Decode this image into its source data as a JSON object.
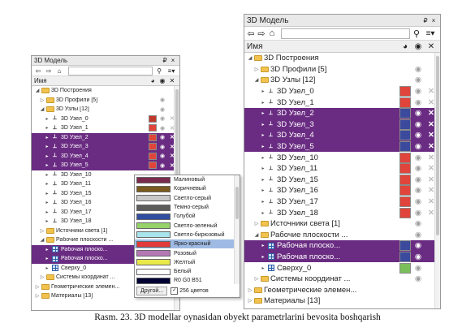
{
  "small_panel": {
    "title": "3D Модель",
    "pin": "₽",
    "close": "×",
    "column_header": "Имя",
    "rows": [
      {
        "label": "3D Построения",
        "depth": 0,
        "exp": "◢",
        "icon": "folder"
      },
      {
        "label": "3D Профили [5]",
        "depth": 1,
        "exp": "▷",
        "icon": "folder",
        "eye": "on"
      },
      {
        "label": "3D Узлы [12]",
        "depth": 1,
        "exp": "◢",
        "icon": "folder",
        "eye": "on"
      },
      {
        "label": "3D Узел_0",
        "depth": 2,
        "exp": "▸",
        "icon": "node",
        "color": "#c0392b",
        "eye": "on",
        "x": "off"
      },
      {
        "label": "3D Узел_1",
        "depth": 2,
        "exp": "▸",
        "icon": "node",
        "color": "#e0443a",
        "eye": "on",
        "x": "off"
      },
      {
        "label": "3D Узел_2",
        "depth": 2,
        "exp": "▸",
        "icon": "node",
        "color": "#e0443a",
        "eye": "on",
        "x": "on",
        "sel": true
      },
      {
        "label": "3D Узел_3",
        "depth": 2,
        "exp": "▸",
        "icon": "node",
        "color": "#e0443a",
        "eye": "on",
        "x": "on",
        "sel": true
      },
      {
        "label": "3D Узел_4",
        "depth": 2,
        "exp": "▸",
        "icon": "node",
        "color": "#e0443a",
        "eye": "on",
        "x": "on",
        "sel": true
      },
      {
        "label": "3D Узел_5",
        "depth": 2,
        "exp": "▸",
        "icon": "node",
        "color": "#e0443a",
        "eye": "on",
        "x": "on",
        "sel": true
      },
      {
        "label": "3D Узел_10",
        "depth": 2,
        "exp": "▸",
        "icon": "node"
      },
      {
        "label": "3D Узел_11",
        "depth": 2,
        "exp": "▸",
        "icon": "node"
      },
      {
        "label": "3D Узел_15",
        "depth": 2,
        "exp": "▸",
        "icon": "node"
      },
      {
        "label": "3D Узел_16",
        "depth": 2,
        "exp": "▸",
        "icon": "node"
      },
      {
        "label": "3D Узел_17",
        "depth": 2,
        "exp": "▸",
        "icon": "node"
      },
      {
        "label": "3D Узел_18",
        "depth": 2,
        "exp": "▸",
        "icon": "node"
      },
      {
        "label": "Источники света [1]",
        "depth": 1,
        "exp": "▷",
        "icon": "folder"
      },
      {
        "label": "Рабочие плоскости ...",
        "depth": 1,
        "exp": "◢",
        "icon": "folder"
      },
      {
        "label": "Рабочая плоско...",
        "depth": 2,
        "exp": "▸",
        "icon": "grid",
        "sel": true
      },
      {
        "label": "Рабочая плоско...",
        "depth": 2,
        "exp": "▸",
        "icon": "grid",
        "sel": true
      },
      {
        "label": "Сверху_0",
        "depth": 2,
        "exp": "▸",
        "icon": "grid"
      },
      {
        "label": "Системы координат ...",
        "depth": 1,
        "exp": "▷",
        "icon": "folder"
      },
      {
        "label": "Геометрические элемен...",
        "depth": 0,
        "exp": "▷",
        "icon": "folder"
      },
      {
        "label": "Материалы [13]",
        "depth": 0,
        "exp": "▷",
        "icon": "folder"
      }
    ]
  },
  "large_panel": {
    "title": "3D Модель",
    "pin": "₽",
    "close": "×",
    "column_header": "Имя",
    "rows": [
      {
        "label": "3D Построения",
        "depth": 0,
        "exp": "◢",
        "icon": "folder"
      },
      {
        "label": "3D Профили [5]",
        "depth": 1,
        "exp": "▷",
        "icon": "folder",
        "eye": "on"
      },
      {
        "label": "3D Узлы [12]",
        "depth": 1,
        "exp": "◢",
        "icon": "folder",
        "eye": "on"
      },
      {
        "label": "3D Узел_0",
        "depth": 2,
        "exp": "▸",
        "icon": "node",
        "color": "#e0443a",
        "eye": "on",
        "x": "off"
      },
      {
        "label": "3D Узел_1",
        "depth": 2,
        "exp": "▸",
        "icon": "node",
        "color": "#e0443a",
        "eye": "on",
        "x": "off"
      },
      {
        "label": "3D Узел_2",
        "depth": 2,
        "exp": "▸",
        "icon": "node",
        "color": "#3b4a9c",
        "eye": "on",
        "x": "on",
        "sel": true
      },
      {
        "label": "3D Узел_3",
        "depth": 2,
        "exp": "▸",
        "icon": "node",
        "color": "#3b4a9c",
        "eye": "on",
        "x": "on",
        "sel": true
      },
      {
        "label": "3D Узел_4",
        "depth": 2,
        "exp": "▸",
        "icon": "node",
        "color": "#3b4a9c",
        "eye": "on",
        "x": "on",
        "sel": true
      },
      {
        "label": "3D Узел_5",
        "depth": 2,
        "exp": "▸",
        "icon": "node",
        "color": "#3b4a9c",
        "eye": "on",
        "x": "on",
        "sel": true
      },
      {
        "label": "3D Узел_10",
        "depth": 2,
        "exp": "▸",
        "icon": "node",
        "color": "#e0443a",
        "eye": "on",
        "x": "off"
      },
      {
        "label": "3D Узел_11",
        "depth": 2,
        "exp": "▸",
        "icon": "node",
        "color": "#e0443a",
        "eye": "on",
        "x": "off"
      },
      {
        "label": "3D Узел_15",
        "depth": 2,
        "exp": "▸",
        "icon": "node",
        "color": "#e0443a",
        "eye": "on",
        "x": "off"
      },
      {
        "label": "3D Узел_16",
        "depth": 2,
        "exp": "▸",
        "icon": "node",
        "color": "#e0443a",
        "eye": "on",
        "x": "off"
      },
      {
        "label": "3D Узел_17",
        "depth": 2,
        "exp": "▸",
        "icon": "node",
        "color": "#e0443a",
        "eye": "on",
        "x": "off"
      },
      {
        "label": "3D Узел_18",
        "depth": 2,
        "exp": "▸",
        "icon": "node",
        "color": "#e0443a",
        "eye": "on",
        "x": "off"
      },
      {
        "label": "Источники света [1]",
        "depth": 1,
        "exp": "▷",
        "icon": "folder",
        "eye": "on"
      },
      {
        "label": "Рабочие плоскости ...",
        "depth": 1,
        "exp": "◢",
        "icon": "folder",
        "eye": "on"
      },
      {
        "label": "Рабочая плоско...",
        "depth": 2,
        "exp": "▸",
        "icon": "grid",
        "color": "#3b4a9c",
        "eye": "on",
        "sel": true
      },
      {
        "label": "Рабочая плоско...",
        "depth": 2,
        "exp": "▸",
        "icon": "grid",
        "color": "#3b4a9c",
        "eye": "on",
        "sel": true
      },
      {
        "label": "Сверху_0",
        "depth": 2,
        "exp": "▸",
        "icon": "grid",
        "color": "#7bbf5a",
        "eye": "on"
      },
      {
        "label": "Системы координат ...",
        "depth": 1,
        "exp": "▷",
        "icon": "folder",
        "eye": "on"
      },
      {
        "label": "Геометрические элемен...",
        "depth": 0,
        "exp": "▷",
        "icon": "folder"
      },
      {
        "label": "Материалы [13]",
        "depth": 0,
        "exp": "▷",
        "icon": "folder"
      }
    ]
  },
  "color_popup": {
    "items": [
      {
        "name": "Малиновый",
        "color": "#7a2a4c"
      },
      {
        "name": "Коричневый",
        "color": "#7a5a1e"
      },
      {
        "name": "Светло-серый",
        "color": "#c8c8c8"
      },
      {
        "name": "Темно-серый",
        "color": "#5c5c5c"
      },
      {
        "name": "Голубой",
        "color": "#2f4ea0"
      },
      {
        "name": "Светло-зеленый",
        "color": "#97d26a"
      },
      {
        "name": "Светло-бирюзовый",
        "color": "#a9e4ec"
      },
      {
        "name": "Ярко-красный",
        "color": "#e23a3a",
        "selected": true
      },
      {
        "name": "Розовый",
        "color": "#b478b4"
      },
      {
        "name": "Желтый",
        "color": "#e9e94a"
      },
      {
        "name": "Белый",
        "color": "#ffffff"
      },
      {
        "name": "R0 G0 B51",
        "color": "#000033"
      }
    ],
    "other_button": "Другой...",
    "checkbox_label": "256 цветов",
    "checkbox_checked": true
  },
  "caption": "Rasm. 23. 3D modellar oynasidan obyekt parametrlarini bevosita boshqarish"
}
